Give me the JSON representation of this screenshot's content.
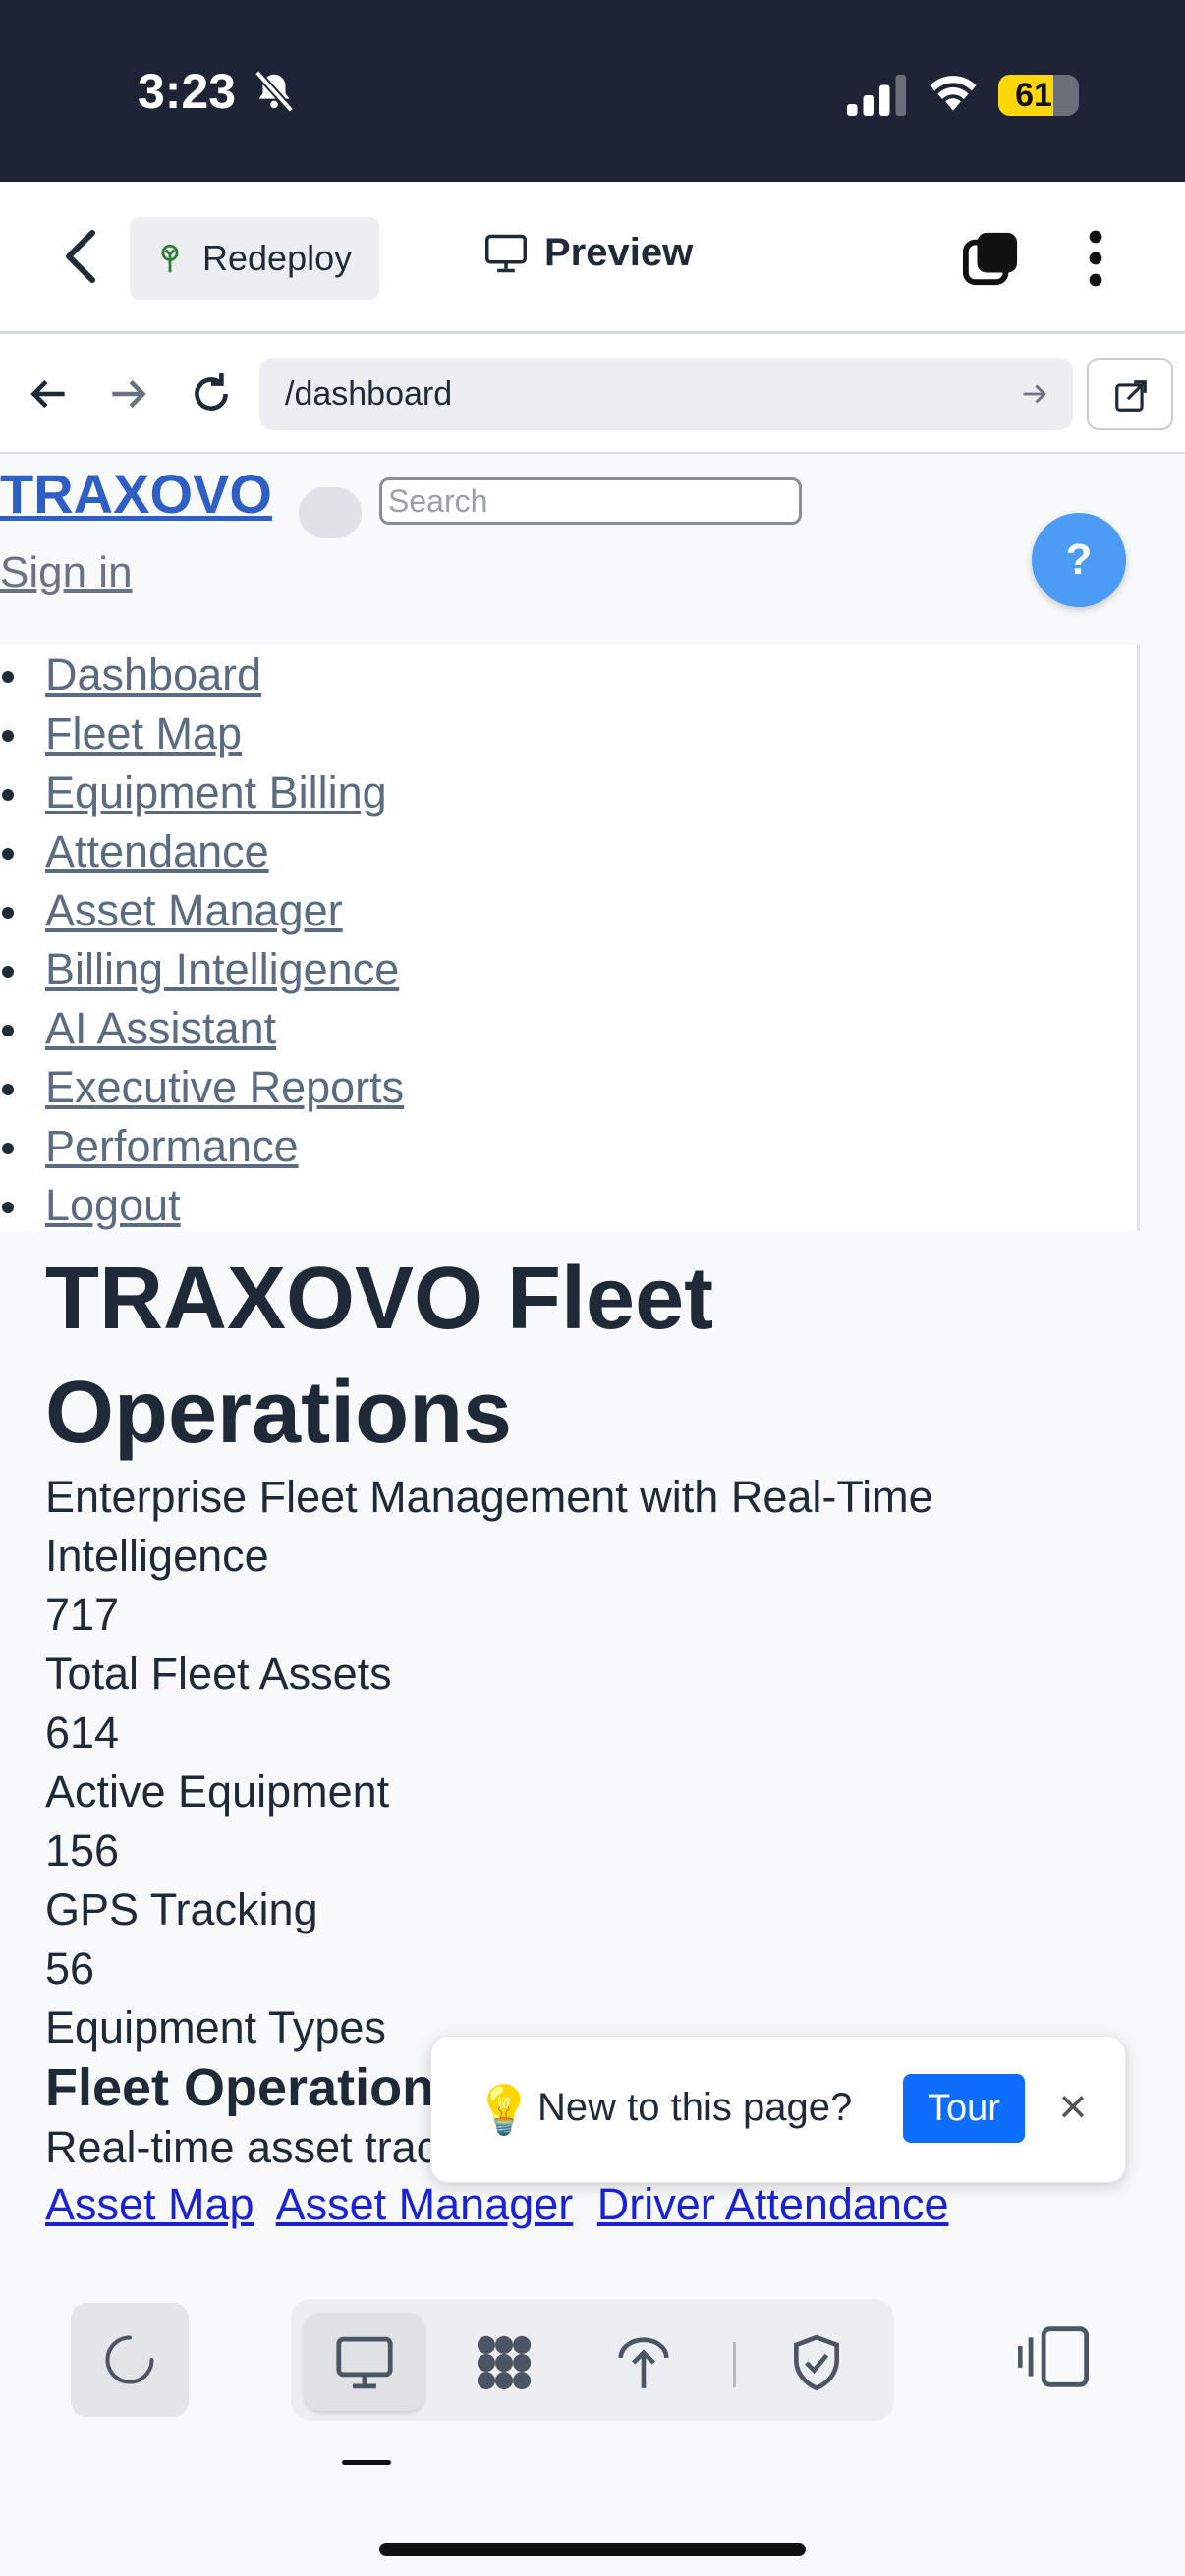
{
  "status_bar": {
    "time": "3:23",
    "battery": "61"
  },
  "app_bar": {
    "redeploy_label": "Redeploy",
    "preview_label": "Preview"
  },
  "browser": {
    "url": "/dashboard"
  },
  "site": {
    "logo": "TRAXOVO",
    "search_placeholder": "Search",
    "sign_in": "Sign in",
    "help": "?"
  },
  "nav": {
    "items": [
      "Dashboard",
      "Fleet Map",
      "Equipment Billing",
      "Attendance",
      "Asset Manager",
      "Billing Intelligence",
      "AI Assistant",
      "Executive Reports",
      "Performance",
      "Logout"
    ]
  },
  "hero": {
    "title": "TRAXOVO Fleet Operations",
    "subtitle": "Enterprise Fleet Management with Real-Time Intelligence"
  },
  "stats": [
    {
      "value": "717",
      "label": "Total Fleet Assets"
    },
    {
      "value": "614",
      "label": "Active Equipment"
    },
    {
      "value": "156",
      "label": "GPS Tracking"
    },
    {
      "value": "56",
      "label": "Equipment Types"
    }
  ],
  "ops": {
    "title": "Fleet Operations",
    "subtitle": "Real-time asset tracking",
    "links": [
      "Asset Map",
      "Asset Manager",
      "Driver Attendance"
    ]
  },
  "tour_popup": {
    "icon": "lightbulb-icon",
    "question": "New to this page?",
    "button": "Tour",
    "close": "×"
  },
  "colors": {
    "status_bar_bg": "#1e2436",
    "battery": "#ffd60a",
    "logo": "#2f5fc4",
    "help_button": "#4c9bf5",
    "tour_button": "#0d6efd",
    "links": "#1a22d6"
  }
}
